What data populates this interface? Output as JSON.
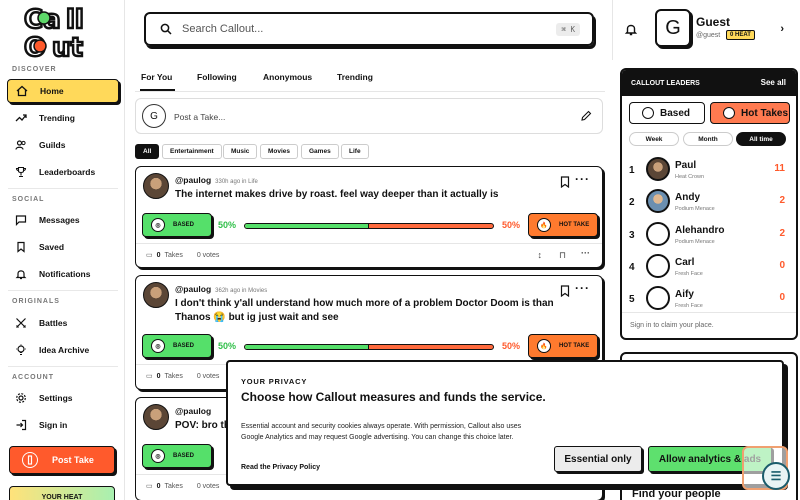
{
  "app": {
    "name": "Callout"
  },
  "search": {
    "placeholder": "Search Callout...",
    "shortcut": "⌘ K"
  },
  "user": {
    "name": "Guest",
    "handle": "@guest",
    "heat": "0 HEAT",
    "initial": "G"
  },
  "sidebar": {
    "discover_label": "DISCOVER",
    "social_label": "SOCIAL",
    "originals_label": "ORIGINALS",
    "account_label": "ACCOUNT",
    "items": [
      {
        "label": "Home",
        "icon": "home-icon"
      },
      {
        "label": "Trending",
        "icon": "trending-icon"
      },
      {
        "label": "Guilds",
        "icon": "users-icon"
      },
      {
        "label": "Leaderboards",
        "icon": "trophy-icon"
      },
      {
        "label": "Messages",
        "icon": "chat-icon"
      },
      {
        "label": "Saved",
        "icon": "bookmark-icon"
      },
      {
        "label": "Notifications",
        "icon": "bell-icon"
      },
      {
        "label": "Battles",
        "icon": "swords-icon"
      },
      {
        "label": "Idea Archive",
        "icon": "bulb-icon"
      },
      {
        "label": "Settings",
        "icon": "gear-icon"
      },
      {
        "label": "Sign in",
        "icon": "sign-in-icon"
      }
    ],
    "post_take": "Post Take",
    "your_heat": "YOUR HEAT"
  },
  "feed": {
    "tabs": [
      "For You",
      "Following",
      "Anonymous",
      "Trending"
    ],
    "composer_placeholder": "Post a Take...",
    "composer_initial": "G",
    "filters": [
      "All",
      "Entertainment",
      "Music",
      "Movies",
      "Games",
      "Life"
    ],
    "posts": [
      {
        "handle": "@paulog",
        "meta": "330h ago in Life",
        "text": "The internet makes drive by roast. feel way deeper than it actually is",
        "based_pct": "50%",
        "hot_pct": "50%",
        "based_ratio": 0.5,
        "takes": "0",
        "takes_label": "Takes",
        "votes": "0 votes"
      },
      {
        "handle": "@paulog",
        "meta": "362h ago in Movies",
        "text": "I don't think y'all understand how much more of a problem Doctor Doom is than Thanos 😭 but ig just wait and see",
        "based_pct": "50%",
        "hot_pct": "50%",
        "based_ratio": 0.5,
        "takes": "0",
        "takes_label": "Takes",
        "votes": "0 votes"
      },
      {
        "handle": "@paulog",
        "meta": "",
        "text": "POV: bro th",
        "takes": "0",
        "takes_label": "Takes",
        "votes": "0 votes"
      }
    ],
    "based_label": "BASED",
    "hot_label": "HOT TAKE"
  },
  "leaders": {
    "title": "CALLOUT LEADERS",
    "see_all": "See all",
    "toggles": [
      "Based",
      "Hot Takes"
    ],
    "periods": [
      "Week",
      "Month",
      "All time"
    ],
    "rows": [
      {
        "rank": "1",
        "name": "Paul",
        "sub": "Heat Crown",
        "score": "11"
      },
      {
        "rank": "2",
        "name": "Andy",
        "sub": "Podium Menace",
        "score": "2"
      },
      {
        "rank": "3",
        "name": "Alehandro",
        "sub": "Podium Menace",
        "score": "2"
      },
      {
        "rank": "4",
        "name": "Carl",
        "sub": "Fresh Face",
        "score": "0"
      },
      {
        "rank": "5",
        "name": "Aify",
        "sub": "Fresh Face",
        "score": "0"
      }
    ],
    "footer": "Sign in to claim your place."
  },
  "find_people": "Find your people",
  "privacy": {
    "kicker": "YOUR PRIVACY",
    "title": "Choose how Callout measures and funds the service.",
    "body": "Essential account and security cookies always operate. With permission, Callout also uses Google Analytics and may request Google advertising. You can change this choice later.",
    "link": "Read the Privacy Policy",
    "essential": "Essential only",
    "allow": "Allow analytics & ads"
  }
}
